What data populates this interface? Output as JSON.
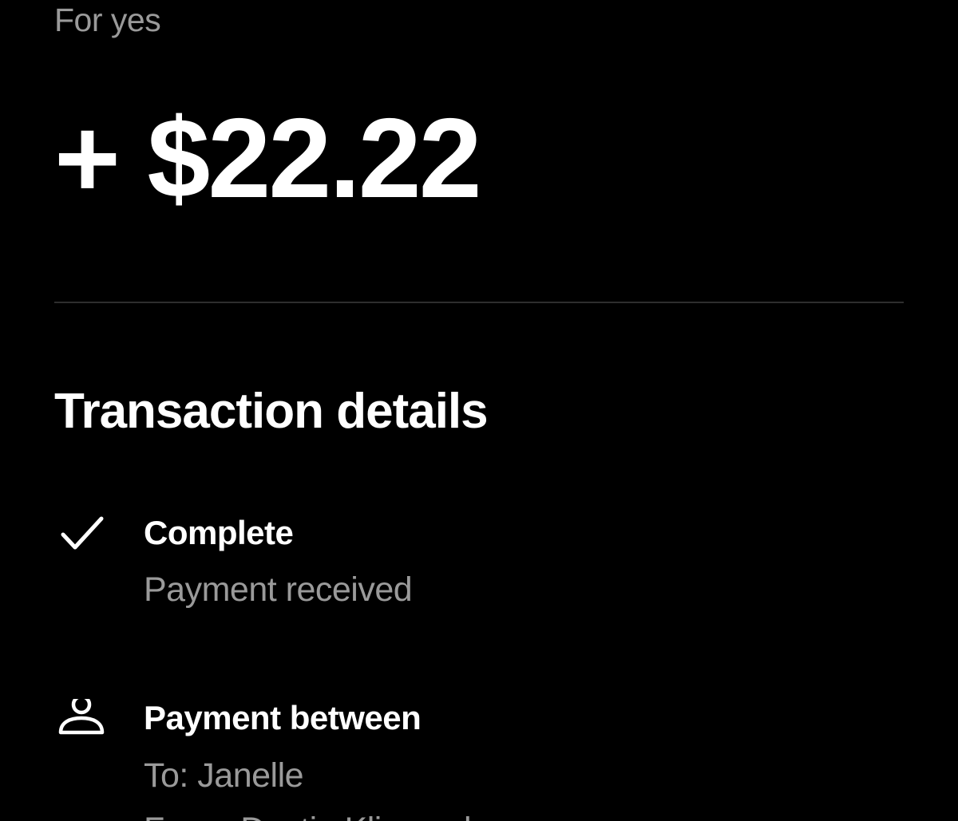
{
  "transaction": {
    "note": "For yes",
    "amount": "+ $22.22"
  },
  "details": {
    "title": "Transaction details",
    "items": [
      {
        "icon": "checkmark-icon",
        "title": "Complete",
        "lines": [
          "Payment received"
        ]
      },
      {
        "icon": "person-icon",
        "title": "Payment between",
        "lines": [
          "To: Janelle",
          "From: Dustin Klimasek"
        ]
      }
    ]
  },
  "colors": {
    "background": "#000000",
    "primary_text": "#ffffff",
    "secondary_text": "#9a9a9a",
    "divider": "#2e2e2e"
  }
}
